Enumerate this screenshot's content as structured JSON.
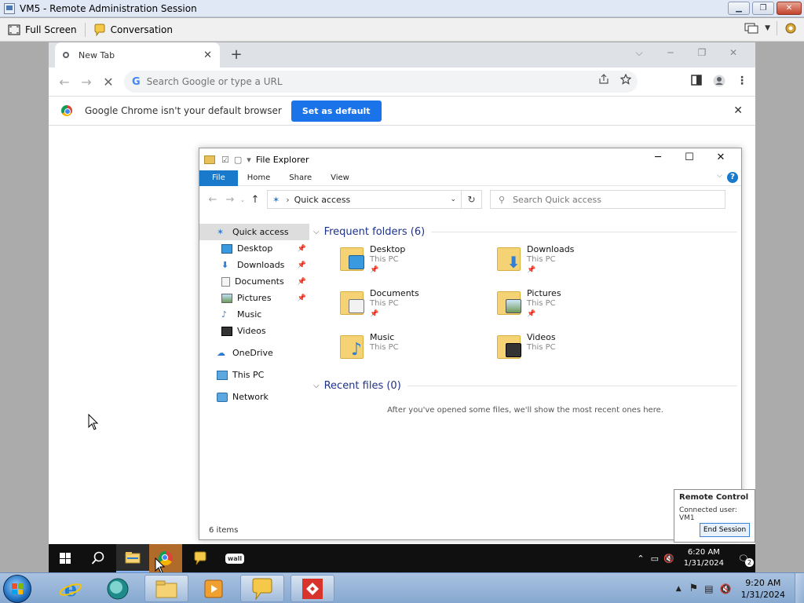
{
  "host_window": {
    "title": "VM5 - Remote Administration Session",
    "controls": [
      "▁",
      "❐",
      "✕"
    ]
  },
  "host_toolbar": {
    "full_screen": "Full Screen",
    "conversation": "Conversation"
  },
  "chrome": {
    "tab_title": "New Tab",
    "tab_close": "✕",
    "new_tab": "+",
    "win_controls": [
      "⌵",
      "─",
      "❐",
      "✕"
    ],
    "omnibox_placeholder": "Search Google or type a URL",
    "google_g": "G",
    "infobar_message": "Google Chrome isn't your default browser",
    "set_default_label": "Set as default",
    "infobar_close": "✕"
  },
  "explorer": {
    "title": "File Explorer",
    "win_controls": [
      "─",
      "☐",
      "✕"
    ],
    "ribbon_tabs": [
      "File",
      "Home",
      "Share",
      "View"
    ],
    "help": "?",
    "address_location": "Quick access",
    "search_placeholder": "Search Quick access",
    "nav": {
      "quick_access": "Quick access",
      "desktop": "Desktop",
      "downloads": "Downloads",
      "documents": "Documents",
      "pictures": "Pictures",
      "music": "Music",
      "videos": "Videos",
      "onedrive": "OneDrive",
      "this_pc": "This PC",
      "network": "Network"
    },
    "frequent_header": "Frequent folders (6)",
    "recent_header": "Recent files (0)",
    "folders": [
      {
        "name": "Desktop",
        "location": "This PC",
        "pinned": true,
        "overlay_color": "#3a9ae0"
      },
      {
        "name": "Downloads",
        "location": "This PC",
        "pinned": true,
        "overlay_color": "#2f7fd6"
      },
      {
        "name": "Documents",
        "location": "This PC",
        "pinned": true,
        "overlay_color": "#f2f2f2"
      },
      {
        "name": "Pictures",
        "location": "This PC",
        "pinned": true,
        "overlay_color": "#7bb3d9"
      },
      {
        "name": "Music",
        "location": "This PC",
        "pinned": false,
        "overlay_color": "#2f7fd6"
      },
      {
        "name": "Videos",
        "location": "This PC",
        "pinned": false,
        "overlay_color": "#333333"
      }
    ],
    "empty_recent_message": "After you've opened some files, we'll show the most recent ones here.",
    "status": "6 items"
  },
  "remote_taskbar": {
    "time": "6:20 AM",
    "date": "1/31/2024",
    "notification_count": "2",
    "app_label": "wall"
  },
  "remote_control": {
    "title": "Remote Control",
    "connected": "Connected user: VM1",
    "end_session": "End Session"
  },
  "host_taskbar": {
    "time": "9:20 AM",
    "date": "1/31/2024"
  },
  "colors": {
    "accent_blue": "#1a73e8",
    "explorer_file_tab": "#1979ca",
    "group_header": "#1e3287",
    "folder_yellow": "#f5d374"
  }
}
